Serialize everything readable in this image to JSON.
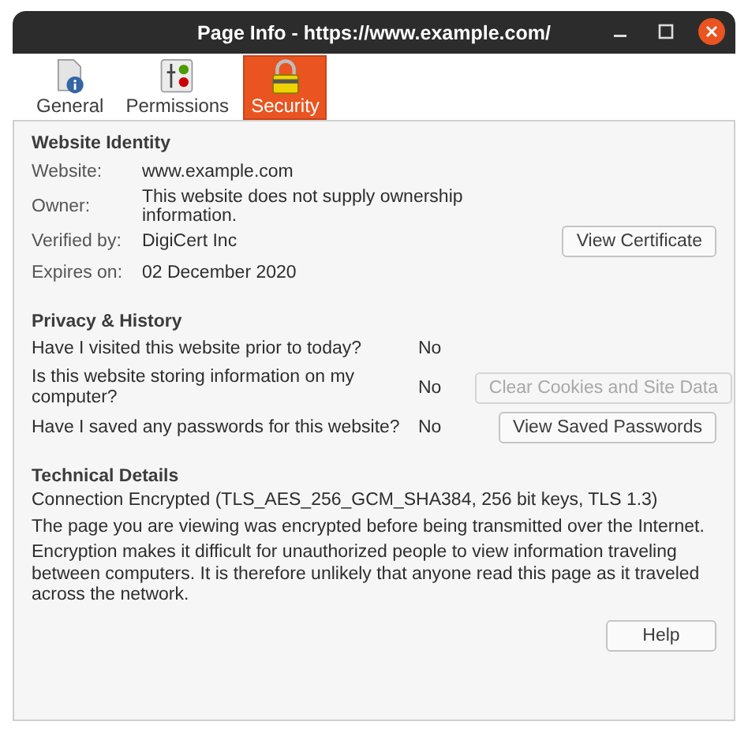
{
  "window": {
    "title": "Page Info - https://www.example.com/"
  },
  "tabs": [
    {
      "label": "General",
      "kind": "general",
      "selected": false
    },
    {
      "label": "Permissions",
      "kind": "permissions",
      "selected": false
    },
    {
      "label": "Security",
      "kind": "security",
      "selected": true
    }
  ],
  "identity": {
    "heading": "Website Identity",
    "rows": [
      {
        "label": "Website:",
        "value": "www.example.com"
      },
      {
        "label": "Owner:",
        "value": "This website does not supply ownership information."
      },
      {
        "label": "Verified by:",
        "value": "DigiCert Inc",
        "button": {
          "label": "View Certificate",
          "disabled": false
        }
      },
      {
        "label": "Expires on:",
        "value": "02 December 2020"
      }
    ]
  },
  "privacy": {
    "heading": "Privacy & History",
    "rows": [
      {
        "question": "Have I visited this website prior to today?",
        "answer": "No"
      },
      {
        "question": "Is this website storing information on my computer?",
        "answer": "No",
        "button": {
          "label": "Clear Cookies and Site Data",
          "disabled": true
        }
      },
      {
        "question": "Have I saved any passwords for this website?",
        "answer": "No",
        "button": {
          "label": "View Saved Passwords",
          "disabled": false
        }
      }
    ]
  },
  "technical": {
    "heading": "Technical Details",
    "lines": [
      "Connection Encrypted (TLS_AES_256_GCM_SHA384, 256 bit keys, TLS 1.3)",
      "The page you are viewing was encrypted before being transmitted over the Internet.",
      "Encryption makes it difficult for unauthorized people to view information traveling between computers. It is therefore unlikely that anyone read this page as it traveled across the network."
    ],
    "button": {
      "label": "Help",
      "disabled": false
    }
  }
}
